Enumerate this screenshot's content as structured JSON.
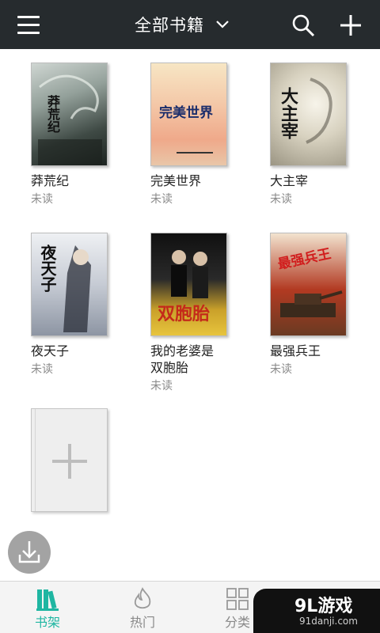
{
  "header": {
    "title": "全部书籍",
    "menu_icon": "hamburger-menu-icon",
    "search_icon": "search-icon",
    "add_icon": "plus-icon",
    "background": "#262b2e"
  },
  "books": [
    {
      "title": "莽荒纪",
      "status": "未读",
      "cover_text": "莽荒纪"
    },
    {
      "title": "完美世界",
      "status": "未读",
      "cover_text": "完美世界"
    },
    {
      "title": "大主宰",
      "status": "未读",
      "cover_text": "大主宰"
    },
    {
      "title": "夜天子",
      "status": "未读",
      "cover_text": "夜天子"
    },
    {
      "title": "我的老婆是双胞胎",
      "status": "未读",
      "cover_text": "双胞胎"
    },
    {
      "title": "最强兵王",
      "status": "未读",
      "cover_text": "最强兵王"
    }
  ],
  "bottom_nav": [
    {
      "label": "书架",
      "icon": "bookshelf-icon",
      "active": true
    },
    {
      "label": "热门",
      "icon": "fire-icon",
      "active": false
    },
    {
      "label": "分类",
      "icon": "category-grid-icon",
      "active": false
    }
  ],
  "watermark": {
    "main": "9L游戏",
    "url": "91danji.com"
  },
  "colors": {
    "accent": "#1fb6a2",
    "inactive": "#888888"
  }
}
